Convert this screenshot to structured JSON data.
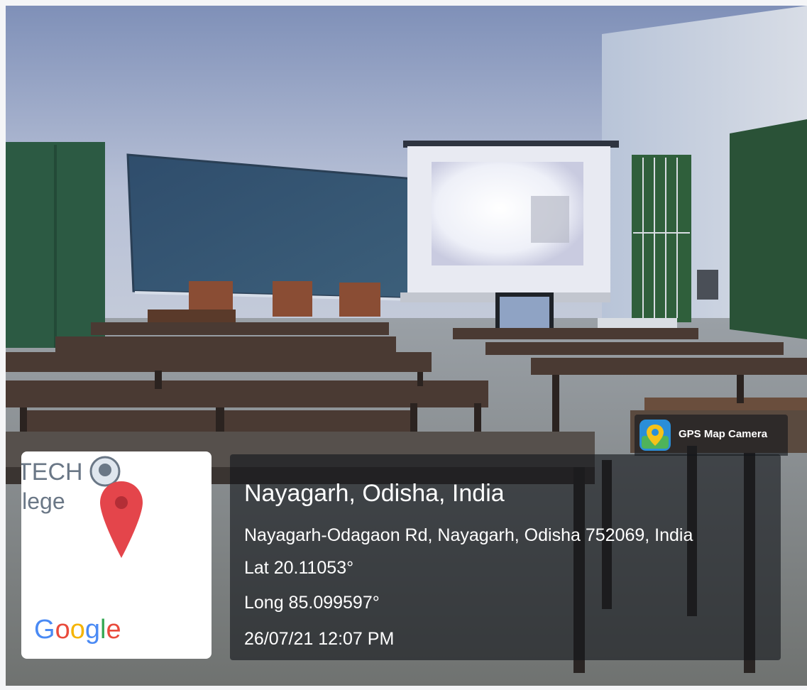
{
  "badge": {
    "app_name": "GPS Map Camera",
    "icon": "map-pin-app-icon",
    "icon_color": "#f5c21a",
    "icon_bg": "#2a8ed8"
  },
  "map": {
    "label_line1": "TECH",
    "label_line2": "llege",
    "brand": "Google",
    "pin_icon": "map-pin-icon",
    "pin_color": "#e4454b"
  },
  "location": {
    "city": "Nayagarh, Odisha, India",
    "address": "Nayagarh-Odagaon Rd, Nayagarh, Odisha 752069, India",
    "latitude": "Lat 20.11053°",
    "longitude": "Long 85.099597°",
    "datetime": "26/07/21 12:07 PM"
  }
}
